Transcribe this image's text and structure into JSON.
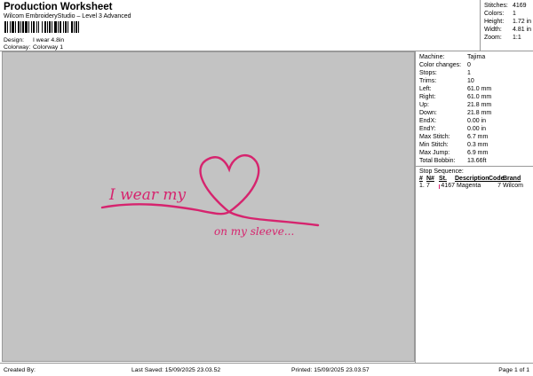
{
  "header": {
    "title": "Production Worksheet",
    "subtitle": "Wilcom EmbroideryStudio – Level 3 Advanced",
    "design_label": "Design:",
    "design_value": "I wear 4.8in",
    "colorway_label": "Colorway:",
    "colorway_value": "Colorway 1"
  },
  "summary": [
    {
      "k": "Stitches:",
      "v": "4169"
    },
    {
      "k": "Colors:",
      "v": "1"
    },
    {
      "k": "Height:",
      "v": "1.72 in"
    },
    {
      "k": "Width:",
      "v": "4.81 in"
    },
    {
      "k": "Zoom:",
      "v": "1:1"
    }
  ],
  "details": [
    {
      "k": "Machine:",
      "v": "Tajima"
    },
    {
      "k": "Color changes:",
      "v": "0"
    },
    {
      "k": "Stops:",
      "v": "1"
    },
    {
      "k": "Trims:",
      "v": "10"
    },
    {
      "k": "Left:",
      "v": "61.0 mm"
    },
    {
      "k": "Right:",
      "v": "61.0 mm"
    },
    {
      "k": "Up:",
      "v": "21.8 mm"
    },
    {
      "k": "Down:",
      "v": "21.8 mm"
    },
    {
      "k": "EndX:",
      "v": "0.00 in"
    },
    {
      "k": "EndY:",
      "v": "0.00 in"
    },
    {
      "k": "Max Stitch:",
      "v": "6.7 mm"
    },
    {
      "k": "Min Stitch:",
      "v": "0.3 mm"
    },
    {
      "k": "Max Jump:",
      "v": "6.9 mm"
    },
    {
      "k": "Total Bobbin:",
      "v": "13.66ft"
    }
  ],
  "stop_sequence": {
    "title": "Stop Sequence:",
    "headers": [
      "#",
      "N#",
      "St.",
      "Description",
      "Code",
      "Brand"
    ],
    "rows": [
      {
        "num": "1.",
        "n": "7",
        "color": "#d6246e",
        "st": "4167",
        "desc": "Magenta",
        "code": "7",
        "brand": "Wilcom"
      }
    ]
  },
  "design": {
    "line1": "I wear my",
    "line2": "on my sleeve...",
    "thread_color": "#d6246e"
  },
  "footer": {
    "created": "Created By:",
    "saved": "Last Saved: 15/09/2025 23.03.52",
    "printed": "Printed: 15/09/2025 23.03.57",
    "page": "Page 1 of 1"
  }
}
